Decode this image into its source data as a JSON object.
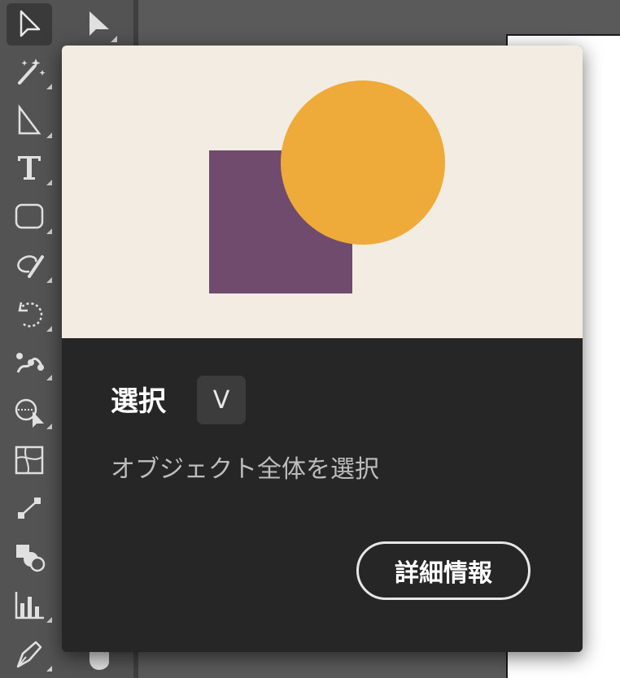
{
  "tooltip": {
    "title": "選択",
    "shortcut": "V",
    "description": "オブジェクト全体を選択",
    "learn_more_label": "詳細情報"
  },
  "preview_colors": {
    "background": "#f3ece2",
    "square": "#714b6d",
    "circle": "#efab39"
  },
  "toolbar": {
    "tools": [
      {
        "name": "selection-tool",
        "icon": "selection-arrow-icon",
        "active": true
      },
      {
        "name": "magic-wand-tool",
        "icon": "magic-wand-icon"
      },
      {
        "name": "line-segment-tool",
        "icon": "line-segment-icon"
      },
      {
        "name": "type-tool",
        "icon": "type-icon"
      },
      {
        "name": "rectangle-tool",
        "icon": "rounded-rectangle-icon"
      },
      {
        "name": "shaper-tool",
        "icon": "shaper-icon"
      },
      {
        "name": "rotate-tool",
        "icon": "rotate-icon"
      },
      {
        "name": "puppet-warp-tool",
        "icon": "puppet-warp-icon"
      },
      {
        "name": "shape-builder-tool",
        "icon": "shape-builder-icon"
      },
      {
        "name": "mesh-tool",
        "icon": "mesh-icon"
      },
      {
        "name": "blend-tool",
        "icon": "blend-icon"
      },
      {
        "name": "live-paint-tool",
        "icon": "live-paint-icon"
      },
      {
        "name": "column-graph-tool",
        "icon": "column-graph-icon"
      },
      {
        "name": "pen-tool",
        "icon": "pen-icon"
      }
    ],
    "secondary": [
      {
        "name": "direct-selection-tool",
        "icon": "direct-selection-arrow-icon"
      },
      {
        "name": "hand-tool",
        "icon": "hand-icon"
      }
    ]
  }
}
